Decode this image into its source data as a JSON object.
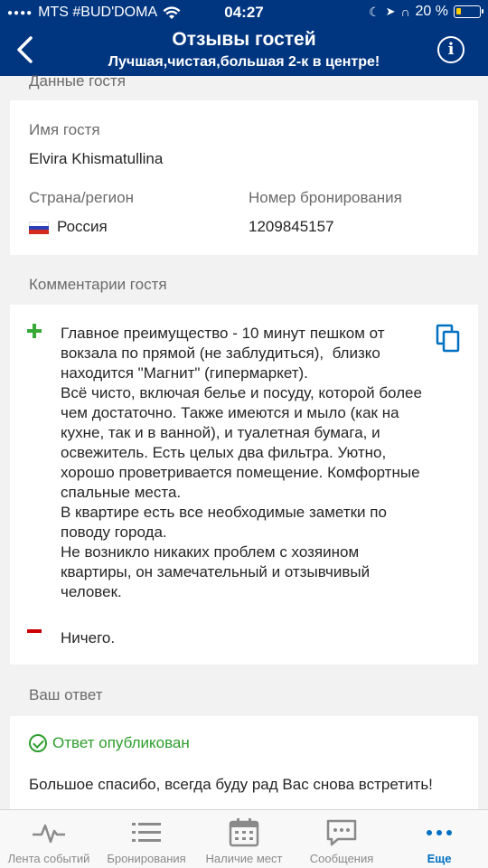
{
  "status_bar": {
    "carrier": "MTS #BUD'DOMA",
    "time": "04:27",
    "battery": "20 %"
  },
  "header": {
    "title": "Отзывы гостей",
    "subtitle": "Лучшая,чистая,большая 2-к в центре!",
    "back_icon": "chevron-left-icon",
    "info_icon": "info-icon"
  },
  "guest_section": {
    "title": "Данные гостя",
    "name_label": "Имя гостя",
    "name_value": "Elvira Khismatullina",
    "country_label": "Страна/регион",
    "country_value": "Россия",
    "booking_label": "Номер бронирования",
    "booking_value": "1209845157"
  },
  "comments_section": {
    "title": "Комментарии гостя",
    "positive": "Главное преимущество - 10 минут пешком от вокзала по прямой (не заблудиться),  близко находится \"Магнит\" (гипермаркет).\nВсё чисто, включая белье и посуду, которой более чем достаточно. Также имеются и мыло (как на кухне, так и в ванной), и туалетная бумага, и освежитель. Есть целых два фильтра. Уютно, хорошо проветривается помещение. Комфортные спальные места.\nВ квартире есть все необходимые заметки по поводу города.\nНе возникло никаких проблем с хозяином квартиры, он замечательный и отзывчивый человек.",
    "negative": "Ничего.",
    "positive_color": "#36a936",
    "negative_color": "#cc0000"
  },
  "reply_section": {
    "title": "Ваш ответ",
    "status": "Ответ опубликован",
    "text": "Большое спасибо, всегда буду рад Вас снова встретить!"
  },
  "tabbar": {
    "tabs": [
      {
        "label": "Лента событий",
        "icon": "pulse-icon"
      },
      {
        "label": "Бронирования",
        "icon": "list-icon"
      },
      {
        "label": "Наличие мест",
        "icon": "calendar-icon"
      },
      {
        "label": "Сообщения",
        "icon": "message-icon"
      },
      {
        "label": "Еще",
        "icon": "more-icon"
      }
    ],
    "active_color": "#0071c2"
  }
}
